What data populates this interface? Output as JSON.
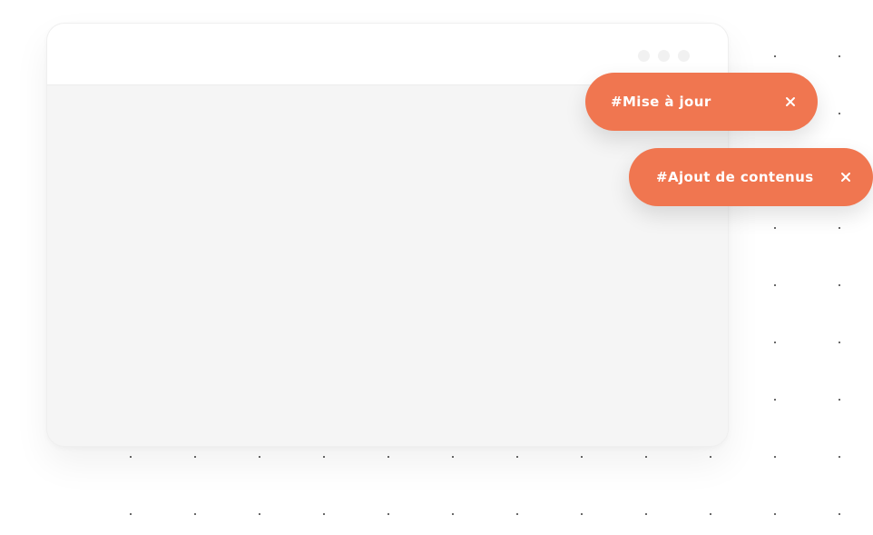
{
  "browser_window": {
    "title_bar_buttons": [
      "window-dot-icon",
      "window-dot-icon",
      "window-dot-icon"
    ]
  },
  "tags": [
    {
      "label": "#Mise à jour",
      "close_icon": "close-icon"
    },
    {
      "label": "#Ajout de contenus",
      "close_icon": "close-icon"
    }
  ],
  "colors": {
    "tag_background": "#f07650",
    "tag_text": "#ffffff",
    "window_body": "#f5f5f5",
    "window_bar": "#ffffff",
    "dot_pattern": "#3a3a3a"
  },
  "decoration": {
    "background_pattern": "dot-grid"
  }
}
